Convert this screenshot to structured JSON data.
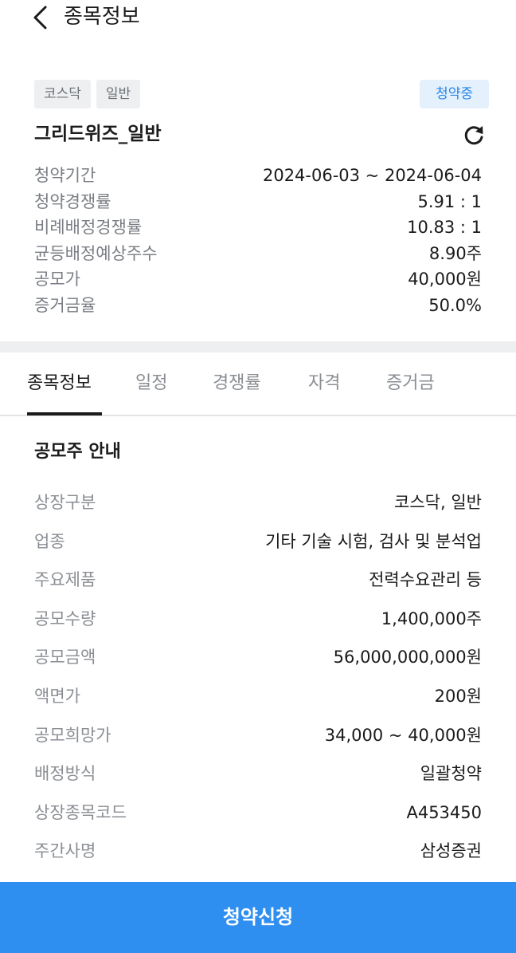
{
  "header": {
    "title": "종목정보"
  },
  "tags": [
    "코스닥",
    "일반"
  ],
  "status_badge": "청약중",
  "stock_name": "그리드위즈_일반",
  "summary": [
    {
      "label": "청약기간",
      "value": "2024-06-03 ~ 2024-06-04"
    },
    {
      "label": "청약경쟁률",
      "value": "5.91  : 1"
    },
    {
      "label": "비례배정경쟁률",
      "value": "10.83  : 1"
    },
    {
      "label": "균등배정예상주수",
      "value": "8.90주"
    },
    {
      "label": "공모가",
      "value": "40,000원"
    },
    {
      "label": "증거금율",
      "value": "50.0%"
    }
  ],
  "tabs": [
    {
      "label": "종목정보",
      "active": true
    },
    {
      "label": "일정",
      "active": false
    },
    {
      "label": "경쟁률",
      "active": false
    },
    {
      "label": "자격",
      "active": false
    },
    {
      "label": "증거금",
      "active": false
    }
  ],
  "section_title": "공모주 안내",
  "details": [
    {
      "label": "상장구분",
      "value": "코스닥, 일반"
    },
    {
      "label": "업종",
      "value": "기타 기술 시험, 검사 및 분석업"
    },
    {
      "label": "주요제품",
      "value": "전력수요관리 등"
    },
    {
      "label": "공모수량",
      "value": "1,400,000주"
    },
    {
      "label": "공모금액",
      "value": "56,000,000,000원"
    },
    {
      "label": "액면가",
      "value": "200원"
    },
    {
      "label": "공모희망가",
      "value": "34,000 ~ 40,000원"
    },
    {
      "label": "배정방식",
      "value": "일괄청약"
    },
    {
      "label": "상장종목코드",
      "value": "A453450"
    },
    {
      "label": "주간사명",
      "value": "삼성증권"
    }
  ],
  "apply_button": "청약신청",
  "colors": {
    "accent": "#2f8ff0",
    "badge_text": "#2a86e6",
    "badge_bg": "#e4f1fd"
  },
  "icons": {
    "back": "chevron-left-icon",
    "refresh": "refresh-icon"
  }
}
